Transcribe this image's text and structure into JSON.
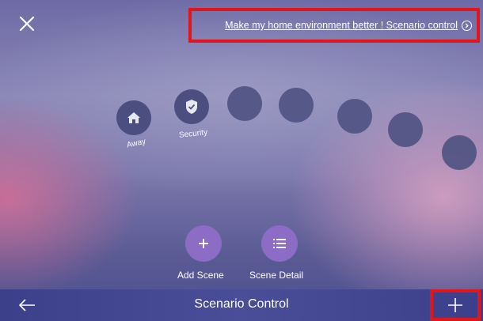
{
  "header": {
    "close_icon": "close-icon",
    "promo_text": "Make my home environment better ! Scenario control",
    "promo_icon": "circle-chevron-right-icon"
  },
  "scenes": [
    {
      "label": "Away",
      "icon": "home-icon"
    },
    {
      "label": "Security",
      "icon": "shield-check-icon"
    },
    {
      "label": "",
      "icon": ""
    },
    {
      "label": "",
      "icon": ""
    },
    {
      "label": "",
      "icon": ""
    },
    {
      "label": "",
      "icon": ""
    },
    {
      "label": "",
      "icon": ""
    }
  ],
  "actions": {
    "add_scene_label": "Add Scene",
    "add_scene_icon": "plus-icon",
    "scene_detail_label": "Scene Detail",
    "scene_detail_icon": "list-icon"
  },
  "bottom_bar": {
    "title": "Scenario Control",
    "back_icon": "arrow-left-icon",
    "add_icon": "plus-icon"
  },
  "colors": {
    "highlight_border": "#e0161c",
    "bottom_bar": "#444791",
    "action_button": "#8c6cc4",
    "scene_circle": "#4b4e7f"
  }
}
